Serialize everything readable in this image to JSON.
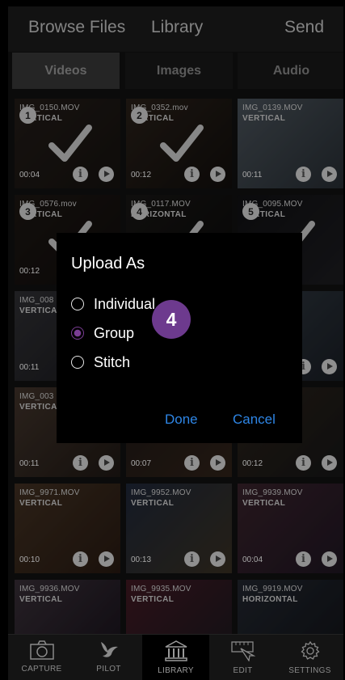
{
  "header": {
    "browse": "Browse Files",
    "library": "Library",
    "send": "Send"
  },
  "tabs": [
    {
      "label": "Videos",
      "active": true
    },
    {
      "label": "Images",
      "active": false
    },
    {
      "label": "Audio",
      "active": false
    }
  ],
  "tiles": [
    {
      "name": "IMG_0150.MOV",
      "orient": "VERTICAL",
      "dur": "00:04",
      "sel": "1",
      "check": true
    },
    {
      "name": "IMG_0352.mov",
      "orient": "VERTICAL",
      "dur": "00:12",
      "sel": "2",
      "check": true
    },
    {
      "name": "IMG_0139.MOV",
      "orient": "VERTICAL",
      "dur": "00:11",
      "sel": "",
      "check": false
    },
    {
      "name": "IMG_0576.mov",
      "orient": "VERTICAL",
      "dur": "00:12",
      "sel": "3",
      "check": true
    },
    {
      "name": "IMG_0117.MOV",
      "orient": "HORIZONTAL",
      "dur": "",
      "sel": "4",
      "check": true
    },
    {
      "name": "IMG_0095.MOV",
      "orient": "VERTICAL",
      "dur": "",
      "sel": "5",
      "check": true
    },
    {
      "name": "IMG_008",
      "orient": "VERTICA",
      "dur": "00:11",
      "sel": "",
      "check": false
    },
    {
      "name": "",
      "orient": "",
      "dur": "",
      "sel": "",
      "check": false
    },
    {
      "name": "",
      "orient": "V",
      "dur": "",
      "sel": "",
      "check": false
    },
    {
      "name": "IMG_003",
      "orient": "VERTICA",
      "dur": "00:11",
      "sel": "",
      "check": false
    },
    {
      "name": "",
      "orient": "",
      "dur": "00:07",
      "sel": "",
      "check": false
    },
    {
      "name": "",
      "orient": "",
      "dur": "00:12",
      "sel": "",
      "check": false
    },
    {
      "name": "IMG_9971.MOV",
      "orient": "VERTICAL",
      "dur": "00:10",
      "sel": "",
      "check": false
    },
    {
      "name": "IMG_9952.MOV",
      "orient": "VERTICAL",
      "dur": "00:13",
      "sel": "",
      "check": false
    },
    {
      "name": "IMG_9939.MOV",
      "orient": "VERTICAL",
      "dur": "00:04",
      "sel": "",
      "check": false
    },
    {
      "name": "IMG_9936.MOV",
      "orient": "VERTICAL",
      "dur": "",
      "sel": "",
      "check": false
    },
    {
      "name": "IMG_9935.MOV",
      "orient": "VERTICAL",
      "dur": "",
      "sel": "",
      "check": false
    },
    {
      "name": "IMG_9919.MOV",
      "orient": "HORIZONTAL",
      "dur": "",
      "sel": "",
      "check": false
    }
  ],
  "modal": {
    "title": "Upload As",
    "options": [
      {
        "label": "Individual",
        "checked": false
      },
      {
        "label": "Group",
        "checked": true
      },
      {
        "label": "Stitch",
        "checked": false
      }
    ],
    "badge": "4",
    "done": "Done",
    "cancel": "Cancel"
  },
  "nav": [
    {
      "label": "CAPTURE",
      "icon": "camera-icon"
    },
    {
      "label": "PILOT",
      "icon": "bird-icon"
    },
    {
      "label": "LIBRARY",
      "icon": "library-icon",
      "active": true
    },
    {
      "label": "EDIT",
      "icon": "edit-icon"
    },
    {
      "label": "SETTINGS",
      "icon": "gear-icon"
    }
  ],
  "colors": {
    "accent": "#2e86e6",
    "purple": "#6d3a8e",
    "background": "#111111"
  }
}
